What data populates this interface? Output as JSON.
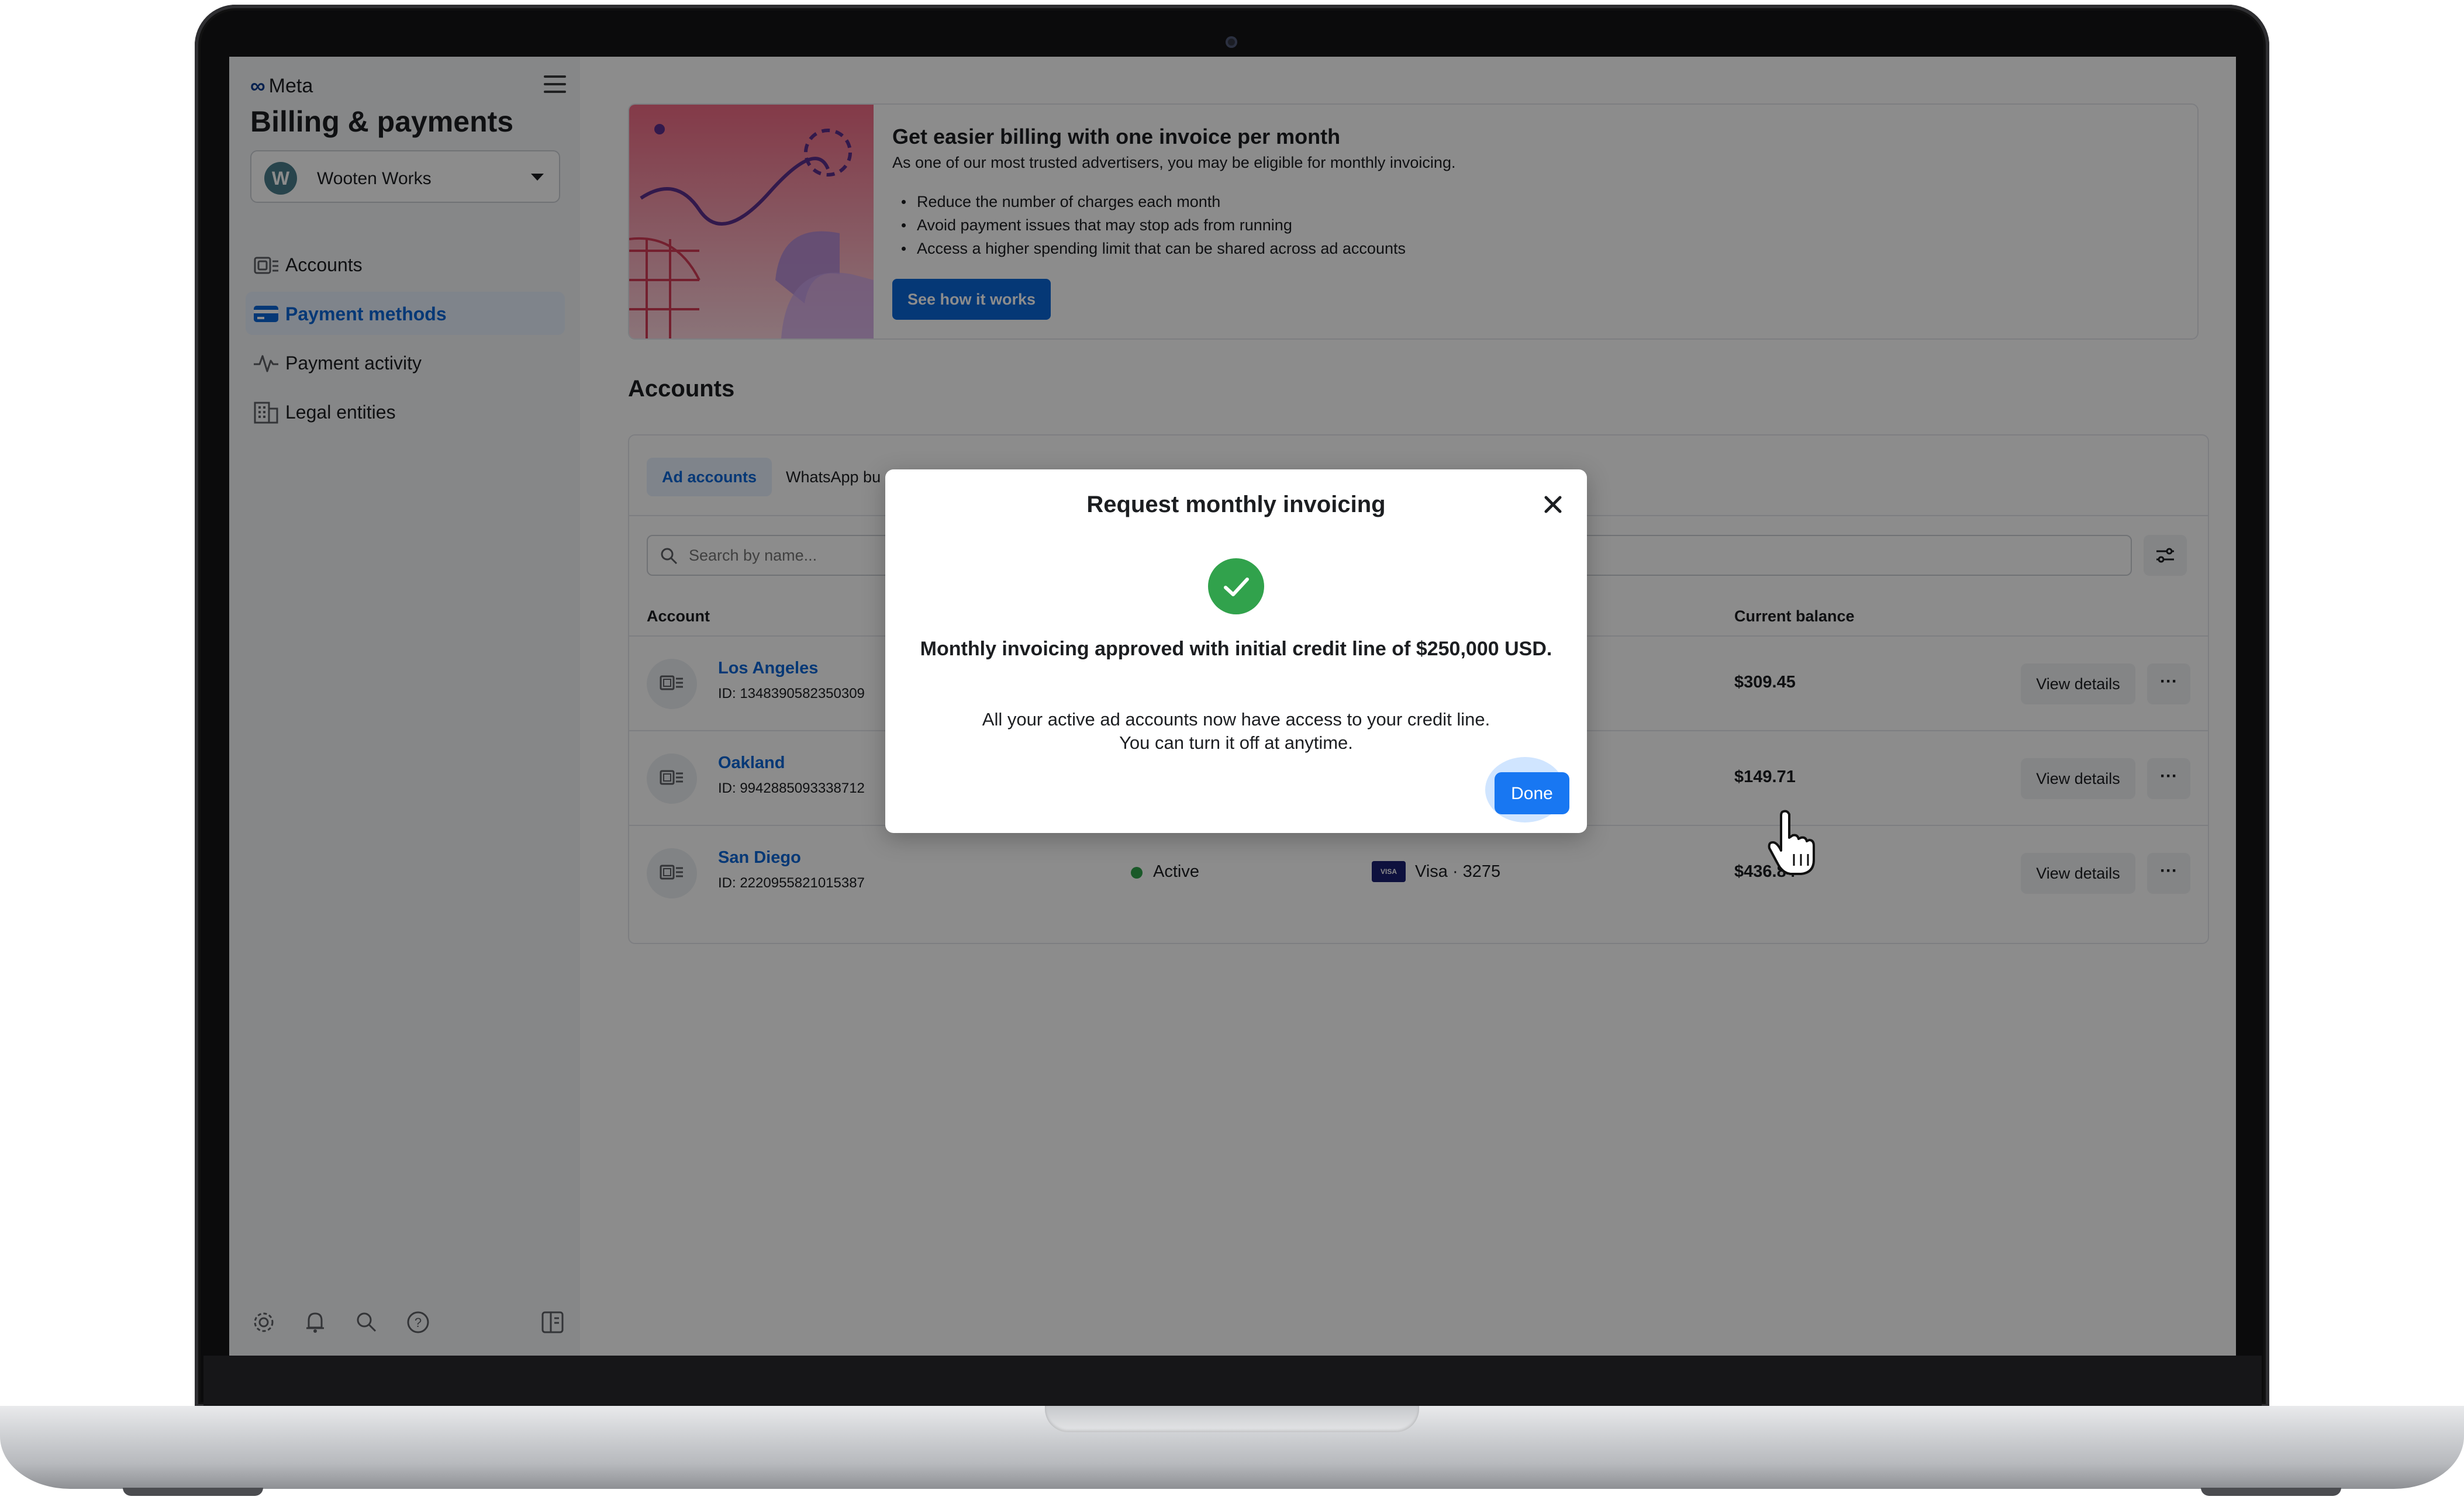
{
  "sidebar": {
    "brand": "Meta",
    "title": "Billing & payments",
    "account_selector": {
      "avatar_initial": "W",
      "name": "Wooten Works"
    },
    "nav": [
      {
        "label": "Accounts",
        "icon": "accounts-icon"
      },
      {
        "label": "Payment methods",
        "icon": "credit-card-icon",
        "active": true
      },
      {
        "label": "Payment activity",
        "icon": "activity-pulse-icon"
      },
      {
        "label": "Legal entities",
        "icon": "building-icon"
      }
    ],
    "footer_icons": [
      "settings-icon",
      "bell-icon",
      "search-icon",
      "help-icon",
      "collapse-panel-icon"
    ]
  },
  "promo": {
    "title": "Get easier billing with one invoice per month",
    "subtitle": "As one of our most trusted advertisers, you may be eligible for monthly invoicing.",
    "bullets": [
      "Reduce the number of charges each month",
      "Avoid payment issues that may stop ads from running",
      "Access a higher spending limit that can be shared across ad accounts"
    ],
    "button": "See how it works"
  },
  "accounts": {
    "section_title": "Accounts",
    "tabs": [
      "Ad accounts",
      "WhatsApp bu"
    ],
    "search_placeholder": "Search by name...",
    "columns": {
      "account": "Account",
      "balance": "Current balance"
    },
    "rows": [
      {
        "name": "Los Angeles",
        "id": "ID: 1348390582350309",
        "status": "",
        "payment_method": "",
        "balance": "$309.45",
        "details": "View details",
        "more": "···"
      },
      {
        "name": "Oakland",
        "id": "ID: 9942885093338712",
        "status": "",
        "payment_method": "",
        "balance": "$149.71",
        "details": "View details",
        "more": "···"
      },
      {
        "name": "San Diego",
        "id": "ID: 2220955821015387",
        "status": "Active",
        "payment_method": "Visa · 3275",
        "card_brand": "VISA",
        "balance": "$436.84",
        "details": "View details",
        "more": "···"
      }
    ]
  },
  "modal": {
    "title": "Request monthly invoicing",
    "headline": "Monthly invoicing approved with initial credit line of $250,000 USD.",
    "body_line1": "All your active ad accounts now have access to your credit line.",
    "body_line2": "You can turn it off at anytime.",
    "done": "Done"
  },
  "colors": {
    "accent": "#0a66d8",
    "success": "#31a24c",
    "status_active": "#31a24c",
    "visa": "#1a1f71"
  }
}
